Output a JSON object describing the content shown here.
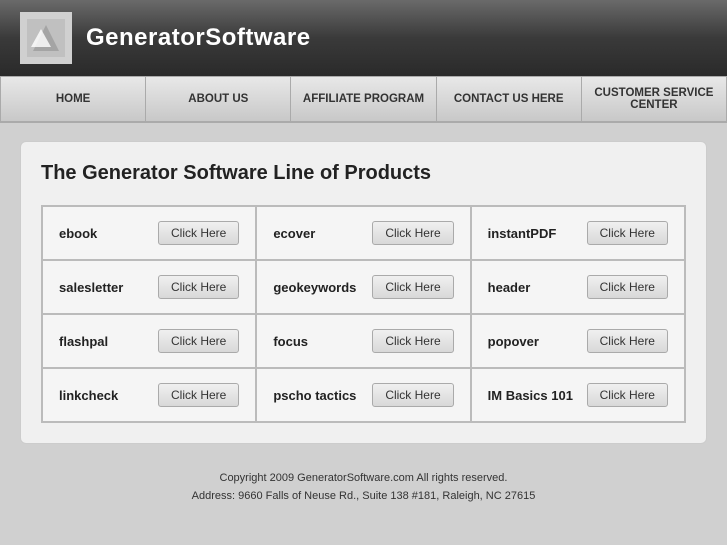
{
  "header": {
    "logo_text": "GeneratorSoftware"
  },
  "nav": {
    "items": [
      {
        "id": "home",
        "label": "HOME"
      },
      {
        "id": "about-us",
        "label": "ABOUT US"
      },
      {
        "id": "affiliate-program",
        "label": "AFFILIATE PROGRAM"
      },
      {
        "id": "contact-us",
        "label": "CONTACT US HERE"
      },
      {
        "id": "customer-service",
        "label": "CUSTOMER SERVICE CENTER"
      }
    ]
  },
  "main": {
    "title": "The Generator Software Line of Products",
    "products": [
      {
        "id": "ebook",
        "name": "ebook",
        "button": "Click Here"
      },
      {
        "id": "ecover",
        "name": "ecover",
        "button": "Click Here"
      },
      {
        "id": "instantpdf",
        "name": "instantPDF",
        "button": "Click Here"
      },
      {
        "id": "salesletter",
        "name": "salesletter",
        "button": "Click Here"
      },
      {
        "id": "geokeywords",
        "name": "geokeywords",
        "button": "Click Here"
      },
      {
        "id": "header",
        "name": "header",
        "button": "Click Here"
      },
      {
        "id": "flashpal",
        "name": "flashpal",
        "button": "Click Here"
      },
      {
        "id": "focus",
        "name": "focus",
        "button": "Click Here"
      },
      {
        "id": "popover",
        "name": "popover",
        "button": "Click Here"
      },
      {
        "id": "linkcheck",
        "name": "linkcheck",
        "button": "Click Here"
      },
      {
        "id": "pscho-tactics",
        "name": "pscho tactics",
        "button": "Click Here"
      },
      {
        "id": "im-basics-101",
        "name": "IM Basics 101",
        "button": "Click Here"
      }
    ]
  },
  "footer": {
    "line1": "Copyright 2009 GeneratorSoftware.com All rights reserved.",
    "line2": "Address: 9660 Falls of Neuse Rd., Suite 138 #181, Raleigh, NC 27615"
  }
}
